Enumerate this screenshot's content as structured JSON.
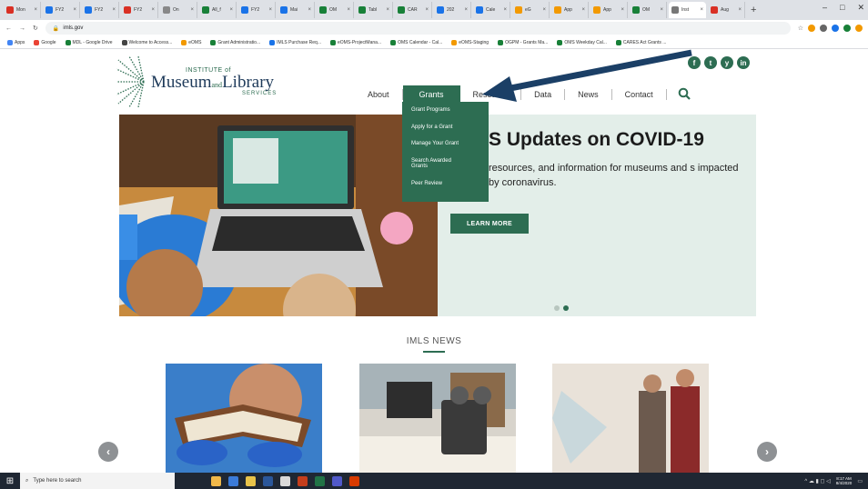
{
  "browser": {
    "tabs": [
      {
        "label": "Mon",
        "color": "#d93025"
      },
      {
        "label": "FY2",
        "color": "#1a73e8"
      },
      {
        "label": "FY2",
        "color": "#1a73e8"
      },
      {
        "label": "FY2",
        "color": "#d93025"
      },
      {
        "label": "On",
        "color": "#888888"
      },
      {
        "label": "All_f",
        "color": "#188038"
      },
      {
        "label": "FY2",
        "color": "#1a73e8"
      },
      {
        "label": "Mai",
        "color": "#1a73e8"
      },
      {
        "label": "OM",
        "color": "#188038"
      },
      {
        "label": "Tabl",
        "color": "#188038"
      },
      {
        "label": "CAR",
        "color": "#188038"
      },
      {
        "label": "202",
        "color": "#1a73e8"
      },
      {
        "label": "Cale",
        "color": "#1a73e8"
      },
      {
        "label": "eG",
        "color": "#f29900"
      },
      {
        "label": "App",
        "color": "#f29900"
      },
      {
        "label": "App",
        "color": "#f29900"
      },
      {
        "label": "OM",
        "color": "#188038"
      },
      {
        "label": "Inst",
        "color": "#777777",
        "active": true
      },
      {
        "label": "Aug",
        "color": "#d93025"
      }
    ],
    "new_tab": "+",
    "window_controls": [
      "–",
      "□",
      "✕"
    ],
    "url": "imls.gov",
    "bookmarks": [
      {
        "label": "Apps",
        "color": "#4285f4"
      },
      {
        "label": "Google",
        "color": "#ea4335"
      },
      {
        "label": "MDL - Google Drive",
        "color": "#188038"
      },
      {
        "label": "Welcome to Access...",
        "color": "#444444"
      },
      {
        "label": "eOMS",
        "color": "#f29900"
      },
      {
        "label": "Grant Administratio...",
        "color": "#188038"
      },
      {
        "label": "IMLS Purchase Req...",
        "color": "#1a73e8"
      },
      {
        "label": "eOMS-ProjectMana...",
        "color": "#188038"
      },
      {
        "label": "OMS Calendar - Cal...",
        "color": "#188038"
      },
      {
        "label": "eOMS-Staging",
        "color": "#f29900"
      },
      {
        "label": "OGPM - Grants Ma...",
        "color": "#188038"
      },
      {
        "label": "OMS Weekday Cal...",
        "color": "#188038"
      },
      {
        "label": "CARES Act Grants ...",
        "color": "#188038"
      }
    ]
  },
  "site": {
    "logo": {
      "line1": "INSTITUTE of",
      "line2_a": "Museum",
      "line2_and": "and",
      "line2_b": "Library",
      "line3": "SERVICES"
    },
    "social": [
      "f",
      "t",
      "y",
      "in"
    ],
    "nav": [
      {
        "label": "About",
        "active": false
      },
      {
        "label": "Grants",
        "active": true
      },
      {
        "label": "Research",
        "active": false
      },
      {
        "label": "Data",
        "active": false
      },
      {
        "label": "News",
        "active": false
      },
      {
        "label": "Contact",
        "active": false
      }
    ],
    "dropdown": [
      "Grant Programs",
      "Apply for a Grant",
      "Manage Your Grant",
      "Search Awarded Grants",
      "Peer Review"
    ],
    "hero": {
      "title": "S Updates on COVID-19",
      "body": "resources, and information for museums and s impacted by coronavirus.",
      "button": "LEARN MORE"
    },
    "news_heading": "IMLS NEWS",
    "prev": "‹",
    "next": "›"
  },
  "taskbar": {
    "search_placeholder": "Type here to search",
    "time": "8:17 AM",
    "date": "8/4/2020"
  },
  "colors": {
    "brand_green": "#2d6d52",
    "arrow_blue": "#1b3f66"
  }
}
